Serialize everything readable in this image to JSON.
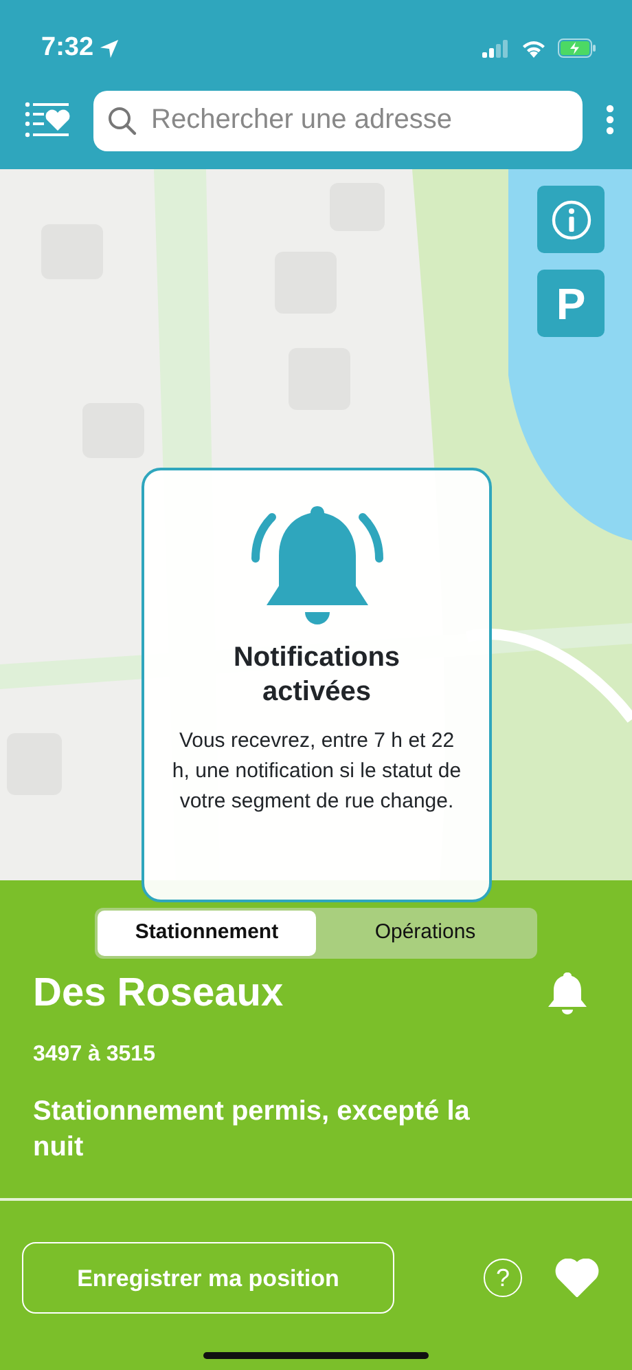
{
  "status_bar": {
    "time": "7:32"
  },
  "header": {
    "search": {
      "placeholder": "Rechercher une adresse"
    }
  },
  "map": {
    "kind": "picture",
    "parking_button": {
      "label": "P"
    }
  },
  "toast": {
    "title": "Notifications activées",
    "message": "Vous recevrez, entre 7 h et 22 h, une notification si le statut de votre segment de rue change."
  },
  "tabs": [
    {
      "label": "Stationnement",
      "selected": true
    },
    {
      "label": "Opérations",
      "selected": false
    }
  ],
  "segment": {
    "street": "Des Roseaux",
    "range": "3497 à 3515",
    "status": "Stationnement permis, excepté la nuit",
    "notifications_on": true
  },
  "footer": {
    "save_button": "Enregistrer ma position",
    "help_button": "?",
    "favorite": true
  }
}
